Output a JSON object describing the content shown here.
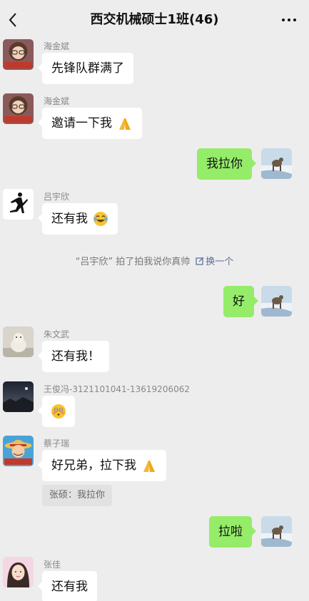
{
  "header": {
    "title": "西交机械硕士1班(46)",
    "back_icon": "chevron-left-icon",
    "more_icon": "more-dots-icon"
  },
  "messages": [
    {
      "sender": "海金斌",
      "text": "先锋队群满了",
      "side": "left"
    },
    {
      "sender": "海金斌",
      "text": "邀请一下我",
      "side": "left",
      "emoji": "folded-hands-emoji"
    },
    {
      "sender": "",
      "text": "我拉你",
      "side": "right"
    },
    {
      "sender": "吕宇欣",
      "text": "还有我",
      "side": "left",
      "emoji": "laughing-emoji"
    },
    {
      "sender": "",
      "text": "好",
      "side": "right"
    },
    {
      "sender": "朱文武",
      "text": "还有我！",
      "side": "left"
    },
    {
      "sender": "王俊冯-3121101041-13619206062",
      "text": "",
      "side": "left",
      "emoji": "flushed-emoji"
    },
    {
      "sender": "蔡子瑞",
      "text": "好兄弟，拉下我",
      "side": "left",
      "emoji": "folded-hands-emoji"
    },
    {
      "sender": "",
      "text": "拉啦",
      "side": "right"
    },
    {
      "sender": "张佳",
      "text": "还有我",
      "side": "left"
    }
  ],
  "system": {
    "pat_text": "“吕宇欣” 拍了拍我说你真帅",
    "pat_link": "换一个"
  },
  "quote": {
    "text": "张硕：我拉你"
  },
  "colors": {
    "background": "#ededed",
    "outgoing_bubble": "#95ec69",
    "incoming_bubble": "#ffffff",
    "link": "#576b95"
  }
}
